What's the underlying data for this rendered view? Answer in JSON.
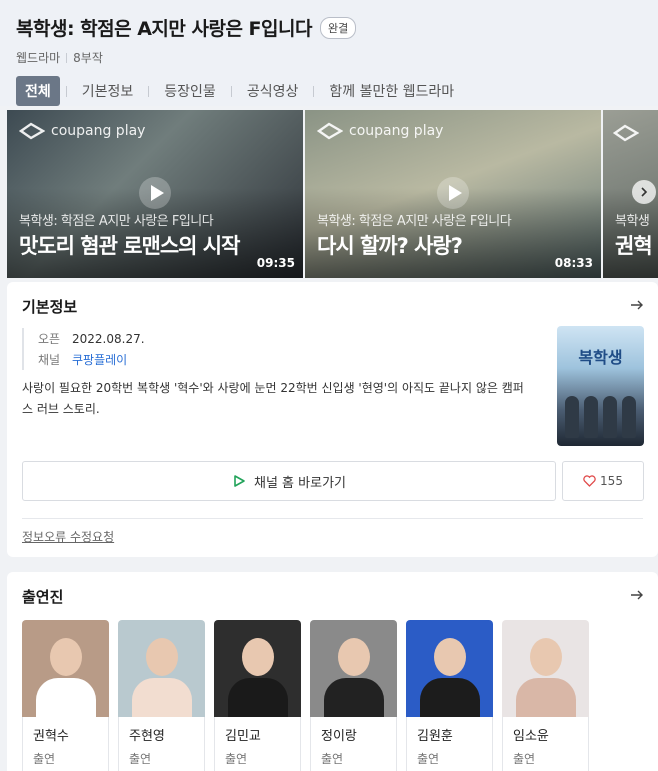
{
  "header": {
    "title": "복학생: 학점은 A지만 사랑은 F입니다",
    "badge": "완결",
    "genre": "웹드라마",
    "episodes": "8부작"
  },
  "tabs": [
    {
      "label": "전체",
      "active": true
    },
    {
      "label": "기본정보",
      "active": false
    },
    {
      "label": "등장인물",
      "active": false
    },
    {
      "label": "공식영상",
      "active": false
    },
    {
      "label": "함께 볼만한 웹드라마",
      "active": false
    }
  ],
  "videos": [
    {
      "logo": "coupang play",
      "subtitle": "복학생: 학점은 A지만 사랑은 F입니다",
      "headline": "맛도리 혐관 로맨스의 시작",
      "duration": "09:35"
    },
    {
      "logo": "coupang play",
      "subtitle": "복학생: 학점은 A지만 사랑은 F입니다",
      "headline": "다시 할까? 사랑?",
      "duration": "08:33"
    },
    {
      "logo": "",
      "subtitle": "복학생",
      "headline": "권혁",
      "duration": ""
    }
  ],
  "info": {
    "section_title": "기본정보",
    "open_label": "오픈",
    "open_value": "2022.08.27.",
    "channel_label": "채널",
    "channel_value": "쿠팡플레이",
    "description": "사랑이 필요한 20학번 복학생 '혁수'와 사랑에 눈먼 22학번 신입생 '현영'의 아직도 끝나지 않은 캠퍼스 러브 스토리.",
    "poster_title": "복학생",
    "channel_button": "채널 홈 바로가기",
    "like_count": "155",
    "report_link": "정보오류 수정요청"
  },
  "cast": {
    "section_title": "출연진",
    "members": [
      {
        "name": "권혁수",
        "role": "출연",
        "bg": "#b89b87",
        "shirt": "#ffffff"
      },
      {
        "name": "주현영",
        "role": "출연",
        "bg": "#b9c9cf",
        "shirt": "#f2ddd0"
      },
      {
        "name": "김민교",
        "role": "출연",
        "bg": "#2e2e2e",
        "shirt": "#1a1a1a"
      },
      {
        "name": "정이랑",
        "role": "출연",
        "bg": "#8a8a8a",
        "shirt": "#222222"
      },
      {
        "name": "김원훈",
        "role": "출연",
        "bg": "#2b5cc6",
        "shirt": "#1c1c1c"
      },
      {
        "name": "임소윤",
        "role": "출연",
        "bg": "#e9e4e4",
        "shirt": "#d9b7a7"
      }
    ]
  },
  "colors": {
    "accent_link": "#2a6fd6",
    "active_tab": "#6b7787",
    "play_icon_green": "#22a35a",
    "heart_red": "#e04a4a"
  }
}
